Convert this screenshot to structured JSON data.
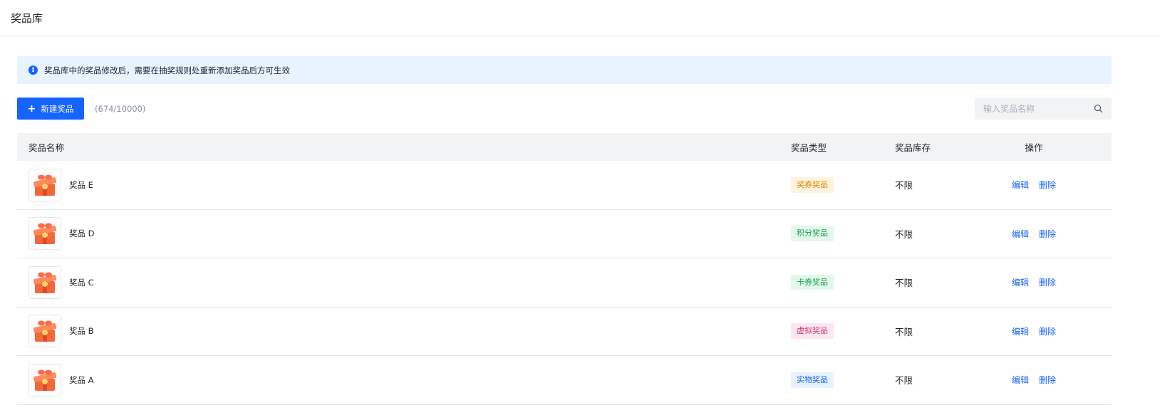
{
  "header": {
    "title": "奖品库"
  },
  "notice": {
    "text": "奖品库中的奖品修改后，需要在抽奖规则处重新添加奖品后方可生效"
  },
  "toolbar": {
    "new_button_label": "新建奖品",
    "count_text": "(674/10000)",
    "search_placeholder": "输入奖品名称",
    "search_value": ""
  },
  "table": {
    "columns": {
      "name": "奖品名称",
      "type": "奖品类型",
      "stock": "奖品库存",
      "operation": "操作"
    },
    "rows": [
      {
        "name": "奖品 E",
        "type": "奖券奖品",
        "stock": "不限",
        "edit": "编辑",
        "delete": "删除"
      },
      {
        "name": "奖品 D",
        "type": "积分奖品",
        "stock": "不限",
        "edit": "编辑",
        "delete": "删除"
      },
      {
        "name": "奖品 C",
        "type": "卡券奖品",
        "stock": "不限",
        "edit": "编辑",
        "delete": "删除"
      },
      {
        "name": "奖品 B",
        "type": "虚拟奖品",
        "stock": "不限",
        "edit": "编辑",
        "delete": "删除"
      },
      {
        "name": "奖品 A",
        "type": "实物奖品",
        "stock": "不限",
        "edit": "编辑",
        "delete": "删除"
      }
    ]
  },
  "tag_colors": {
    "奖券奖品": {
      "bg": "#fff3e0",
      "fg": "#e08a00"
    },
    "积分奖品": {
      "bg": "#e3f7ea",
      "fg": "#16a34a"
    },
    "卡券奖品": {
      "bg": "#e3f7ea",
      "fg": "#16a34a"
    },
    "虚拟奖品": {
      "bg": "#fde7ef",
      "fg": "#d1387a"
    },
    "实物奖品": {
      "bg": "#e8f3ff",
      "fg": "#1664ff"
    }
  },
  "colors": {
    "accent": "#1664ff",
    "notice_bg": "#e8f3ff"
  },
  "icons": {
    "notice": "info-icon",
    "new": "plus-icon",
    "search": "search-icon",
    "thumb": "gift-box-icon"
  }
}
